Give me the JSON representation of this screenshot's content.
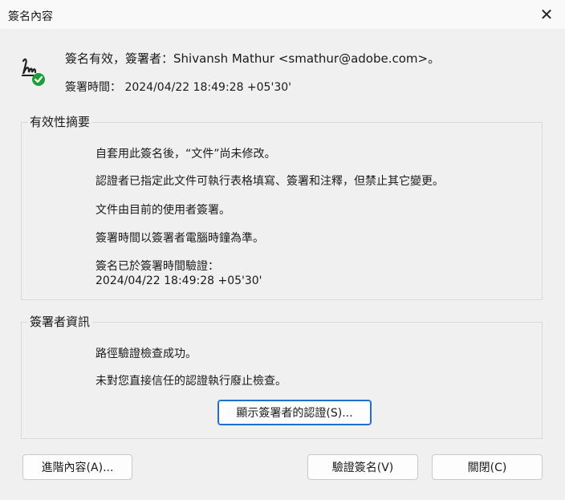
{
  "window": {
    "title": "簽名內容"
  },
  "header": {
    "status_line": "簽名有效，簽署者：Shivansh Mathur <smathur@adobe.com>。",
    "time_label": "簽署時間：",
    "time_value": "2024/04/22 18:49:28 +05'30'"
  },
  "validity_summary": {
    "title": "有效性摘要",
    "lines": [
      "自套用此簽名後，“文件”尚未修改。",
      "認證者已指定此文件可執行表格填寫、簽署和注釋，但禁止其它變更。",
      "文件由目前的使用者簽署。",
      "簽署時間以簽署者電腦時鐘為準。",
      "簽名已於簽署時間驗證：",
      "2024/04/22 18:49:28 +05'30'"
    ]
  },
  "signer_info": {
    "title": "簽署者資訊",
    "lines": [
      "路徑驗證檢查成功。",
      "未對您直接信任的認證執行廢止檢查。"
    ],
    "show_cert_button": "顯示簽署者的認證(S)..."
  },
  "buttons": {
    "advanced": "進階內容(A)...",
    "validate": "驗證簽名(V)",
    "close": "關閉(C)"
  },
  "icons": {
    "close": "close-icon",
    "signature": "signature-valid-icon"
  },
  "colors": {
    "check_green": "#1e9e3a",
    "focus_blue": "#1f6fd0"
  }
}
